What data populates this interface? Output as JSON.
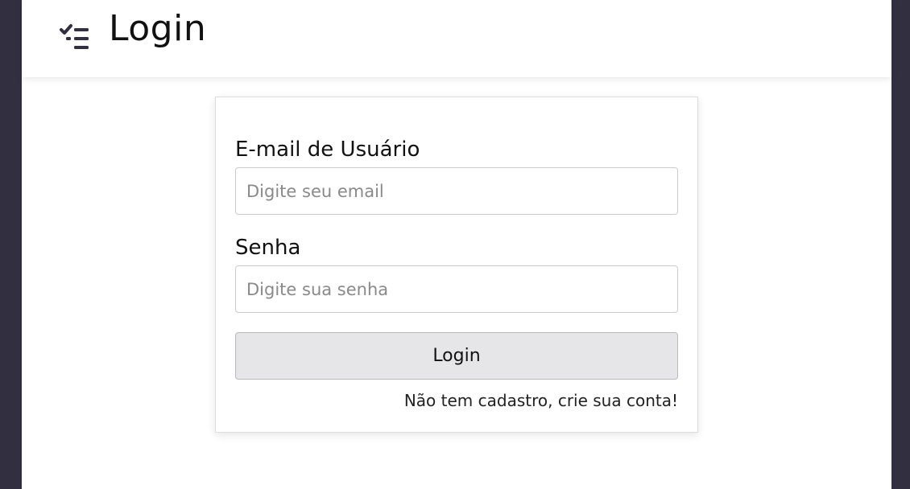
{
  "header": {
    "icon": "checklist-icon",
    "title": "Login"
  },
  "form": {
    "email_label": "E-mail de Usuário",
    "email_placeholder": "Digite seu email",
    "password_label": "Senha",
    "password_placeholder": "Digite sua senha",
    "submit_label": "Login",
    "signup_link": "Não tem cadastro, crie sua conta!"
  },
  "colors": {
    "side_background": "#322f41",
    "icon": "#322f41",
    "button_background": "#e6e6e9"
  }
}
